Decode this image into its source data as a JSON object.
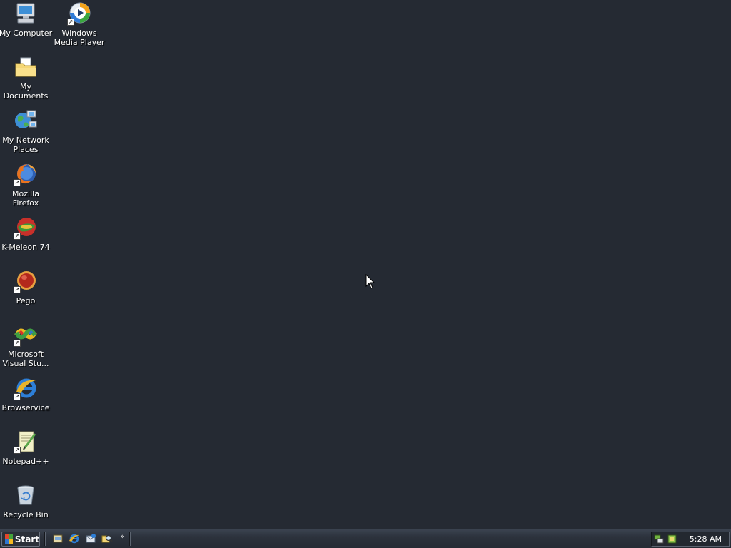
{
  "desktop": {
    "icons": [
      {
        "label": "My Computer",
        "icon": "computer-icon",
        "shortcut": false
      },
      {
        "label": "Windows\nMedia Player",
        "icon": "media-player-icon",
        "shortcut": true
      },
      {
        "label": "My Documents",
        "icon": "documents-folder-icon",
        "shortcut": false
      },
      {
        "label": "My Network\nPlaces",
        "icon": "network-places-icon",
        "shortcut": false
      },
      {
        "label": "Mozilla Firefox",
        "icon": "firefox-icon",
        "shortcut": true
      },
      {
        "label": "K-Meleon 74",
        "icon": "k-meleon-icon",
        "shortcut": true
      },
      {
        "label": "Pego",
        "icon": "pego-icon",
        "shortcut": true
      },
      {
        "label": "Microsoft\nVisual Stu...",
        "icon": "visual-studio-icon",
        "shortcut": true
      },
      {
        "label": "Browservice",
        "icon": "internet-explorer-icon",
        "shortcut": true
      },
      {
        "label": "Notepad++",
        "icon": "notepad-plus-plus-icon",
        "shortcut": true
      },
      {
        "label": "Recycle Bin",
        "icon": "recycle-bin-icon",
        "shortcut": false
      }
    ]
  },
  "taskbar": {
    "start_label": "Start",
    "quick_launch": [
      "show-desktop-icon",
      "internet-explorer-icon",
      "outlook-express-icon",
      "search-icon"
    ],
    "overflow_chevron": "»",
    "tray_icons": [
      "network-tray-icon",
      "safely-remove-hardware-tray-icon"
    ],
    "clock": "5:28 AM"
  },
  "colors": {
    "desktop_background": "#252a33",
    "taskbar": "#2c323c",
    "label_text": "#ffffff"
  }
}
